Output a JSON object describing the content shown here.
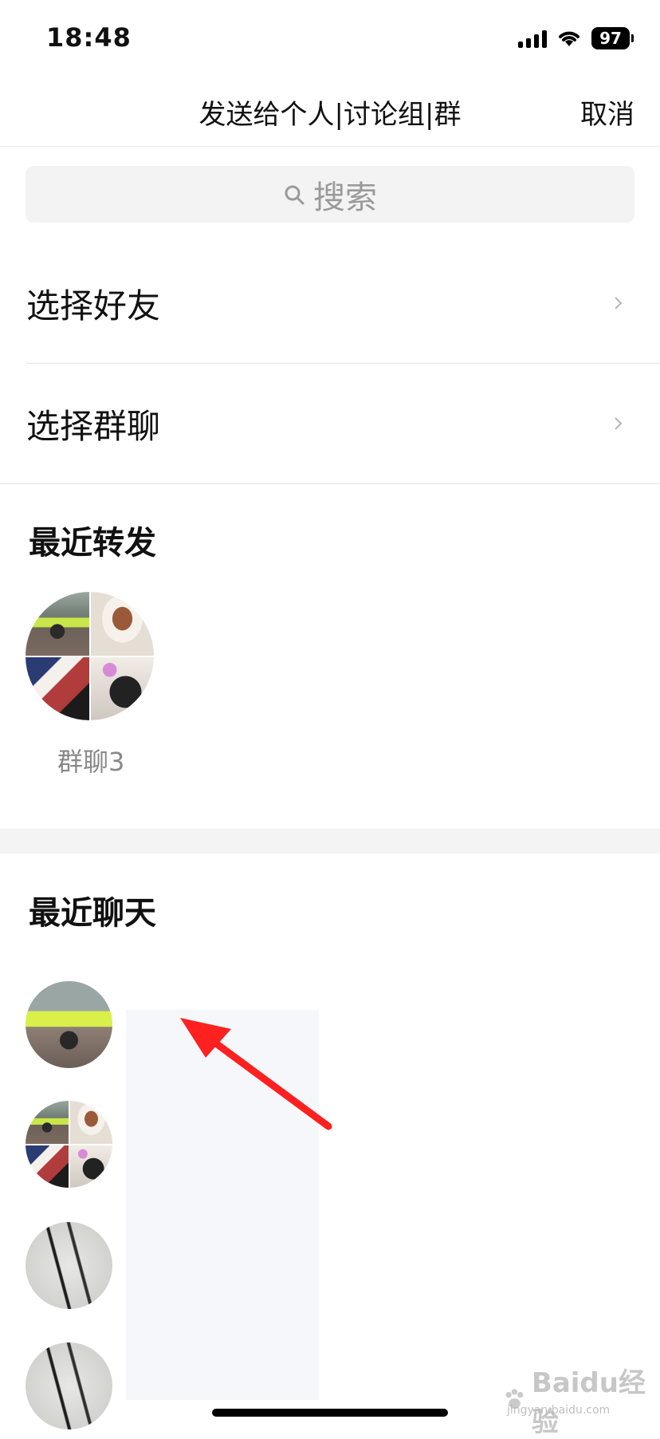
{
  "status_bar": {
    "time": "18:48",
    "battery": "97"
  },
  "nav": {
    "title": "发送给个人|讨论组|群",
    "cancel": "取消"
  },
  "search": {
    "placeholder": "搜索"
  },
  "options": [
    {
      "label": "选择好友"
    },
    {
      "label": "选择群聊"
    }
  ],
  "recent_forward": {
    "title": "最近转发",
    "items": [
      {
        "name": "群聊3"
      }
    ]
  },
  "recent_chats": {
    "title": "最近聊天",
    "partial_text": "· · · · · ·"
  },
  "watermark": {
    "brand": "Baidu经验",
    "url": "jingyan.baidu.com"
  },
  "colors": {
    "arrow": "#ff2020",
    "redaction": "#f6f7fb",
    "section_gap": "#f4f4f4"
  }
}
